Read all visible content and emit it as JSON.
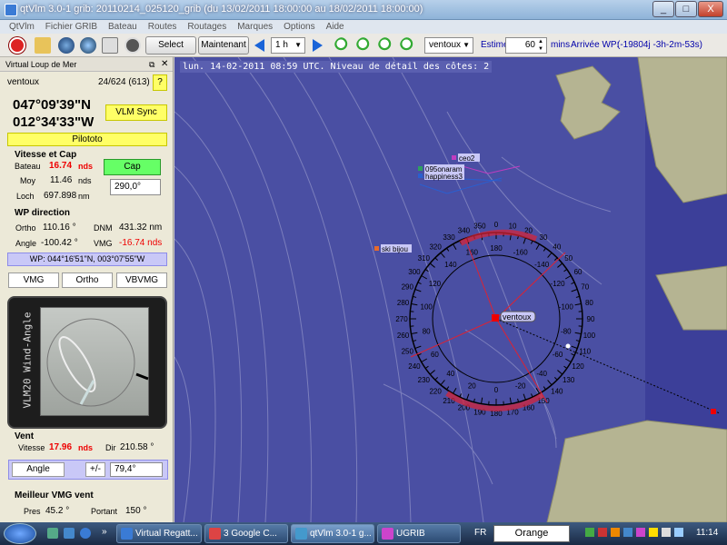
{
  "window": {
    "title": "qtVlm 3.0-1 grib: 20110214_025120_grib (du 13/02/2011 18:00:00 au 18/02/2011 18:00:00)",
    "minimize": "_",
    "maximize": "□",
    "close": "X"
  },
  "menu": [
    "QtVlm",
    "Fichier GRIB",
    "Bateau",
    "Routes",
    "Routages",
    "Marques",
    "Options",
    "Aide"
  ],
  "toolbar": {
    "select": "Select",
    "maintenant": "Maintenant",
    "step": "1 h",
    "boat": "ventoux",
    "estime_label": "Estime",
    "estime_value": "60",
    "mins_label": "mins",
    "arrivee_label": "Arrivée WP:",
    "arrivee_value": "(-19804j -3h-2m-53s)"
  },
  "panel": {
    "title": "Virtual Loup de Mer",
    "boat": "ventoux",
    "rank": "24/624 (613)",
    "help": "?",
    "lat": "047°09'39\"N",
    "lon": "012°34'33\"W",
    "vlm_sync": "VLM Sync",
    "pilototo": "Pilototo",
    "vitesse_cap": "Vitesse et Cap",
    "bateau_label": "Bateau",
    "bateau_value": "16.74",
    "nds": "nds",
    "moy_label": "Moy",
    "moy_value": "11.46",
    "loch_label": "Loch",
    "loch_value": "697.898",
    "nm": "nm",
    "cap_btn": "Cap",
    "cap_value": "290,0°",
    "wp_direction": "WP direction",
    "ortho_label": "Ortho",
    "ortho_value": "110.16 °",
    "dnm_label": "DNM",
    "dnm_value": "431.32 nm",
    "angle_label": "Angle",
    "angle_value": "-100.42 °",
    "vmg_label": "VMG",
    "vmg_value": "-16.74 nds",
    "wp_coords": "WP: 044°16'51\"N, 003°07'55\"W",
    "vmg_btn": "VMG",
    "ortho_btn": "Ortho",
    "vbvmg_btn": "VBVMG",
    "instrument_label": "VLM20 Wind-Angle",
    "vent": "Vent",
    "vent_vitesse_label": "Vitesse",
    "vent_vitesse_value": "17.96",
    "vent_dir_label": "Dir",
    "vent_dir_value": "210.58 °",
    "angle_btn": "Angle",
    "pm_btn": "+/-",
    "angle_input": "79,4°",
    "meilleur_vmg": "Meilleur VMG vent",
    "pres_label": "Pres",
    "pres_value": "45.2 °",
    "portant_label": "Portant",
    "portant_value": "150 °"
  },
  "map": {
    "header": "lun. 14-02-2011 08:59 UTC. Niveau de détail des côtes: 2",
    "boats": [
      {
        "name": "ceo2"
      },
      {
        "name": "095onaram"
      },
      {
        "name": "happiness3"
      },
      {
        "name": "ski bijou"
      },
      {
        "name": "ventoux"
      }
    ],
    "compass_outer": [
      "350",
      "0",
      "10",
      "20",
      "30",
      "40",
      "50",
      "60",
      "70",
      "80",
      "90",
      "100",
      "110",
      "120",
      "130",
      "140",
      "150",
      "160",
      "170",
      "180",
      "190",
      "200",
      "210",
      "220",
      "230",
      "240",
      "250",
      "260",
      "270",
      "280",
      "290",
      "300",
      "310",
      "320",
      "330",
      "340"
    ],
    "compass_inner": [
      "160",
      "180",
      "-160",
      "-140",
      "-120",
      "-100",
      "-80",
      "-60",
      "-40",
      "-20",
      "0",
      "20",
      "40",
      "60",
      "80",
      "100",
      "120",
      "140"
    ]
  },
  "taskbar": {
    "tasks": [
      "Virtual Regatt...",
      "3 Google C...",
      "qtVlm 3.0-1 g...",
      "UGRIB"
    ],
    "lang": "FR",
    "search": "Orange",
    "clock": "11:14"
  },
  "colors": {
    "sea": "#4a4fa3",
    "land": "#b5b492",
    "yellow": "#ffff66",
    "green": "#66ff66",
    "red": "#e00000"
  }
}
